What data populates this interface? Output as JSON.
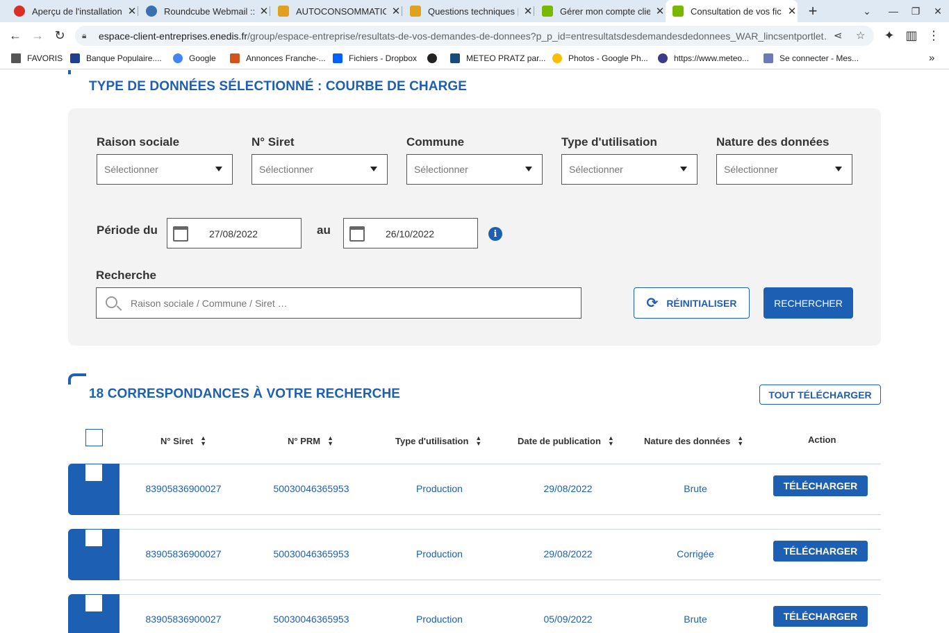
{
  "browser": {
    "tabs": [
      {
        "title": "Aperçu de l'installation",
        "close": "✕"
      },
      {
        "title": "Roundcube Webmail :: I",
        "close": "✕"
      },
      {
        "title": "AUTOCONSOMMATION",
        "close": "✕"
      },
      {
        "title": "Questions techniques |",
        "close": "✕"
      },
      {
        "title": "Gérer mon compte clien",
        "close": "✕"
      },
      {
        "title": "Consultation de vos fic",
        "close": "✕"
      }
    ],
    "new_tab": "+",
    "url_domain": "espace-client-entreprises.enedis.fr",
    "url_path": "/group/espace-entreprise/resultats-de-vos-demandes-de-donnees?p_p_id=entresultatsdesdemandesdedonnees_WAR_lincsentportlet…",
    "bookmarks": [
      "FAVORIS",
      "Banque Populaire....",
      "Google",
      "Annonces Franche-...",
      "Fichiers - Dropbox",
      "",
      "METEO PRATZ par...",
      "Photos - Google Ph...",
      "https://www.meteo...",
      "Se connecter - Mes..."
    ],
    "more": "»"
  },
  "filters": {
    "title": "TYPE DE DONNÉES SÉLECTIONNÉ : COURBE DE CHARGE",
    "labels": [
      "Raison sociale",
      "N° Siret",
      "Commune",
      "Type d'utilisation",
      "Nature des données"
    ],
    "select_placeholder": "Sélectionner",
    "period_label": "Période du",
    "date_from": "27/08/2022",
    "au_label": "au",
    "date_to": "26/10/2022",
    "info": "i",
    "search_label": "Recherche",
    "search_placeholder": "Raison sociale / Commune / Siret …",
    "reset_label": "RÉINITIALISER",
    "search_button": "RECHERCHER"
  },
  "results": {
    "title": "18 CORRESPONDANCES À VOTRE RECHERCHE",
    "download_all": "TOUT TÉLÉCHARGER",
    "headers": [
      "N° Siret",
      "N° PRM",
      "Type d'utilisation",
      "Date de publication",
      "Nature des données",
      "Action"
    ],
    "rows": [
      {
        "siret": "83905836900027",
        "prm": "50030046365953",
        "type": "Production",
        "date": "29/08/2022",
        "nature": "Brute",
        "action": "TÉLÉCHARGER"
      },
      {
        "siret": "83905836900027",
        "prm": "50030046365953",
        "type": "Production",
        "date": "29/08/2022",
        "nature": "Corrigée",
        "action": "TÉLÉCHARGER"
      },
      {
        "siret": "83905836900027",
        "prm": "50030046365953",
        "type": "Production",
        "date": "05/09/2022",
        "nature": "Brute",
        "action": "TÉLÉCHARGER"
      }
    ]
  }
}
